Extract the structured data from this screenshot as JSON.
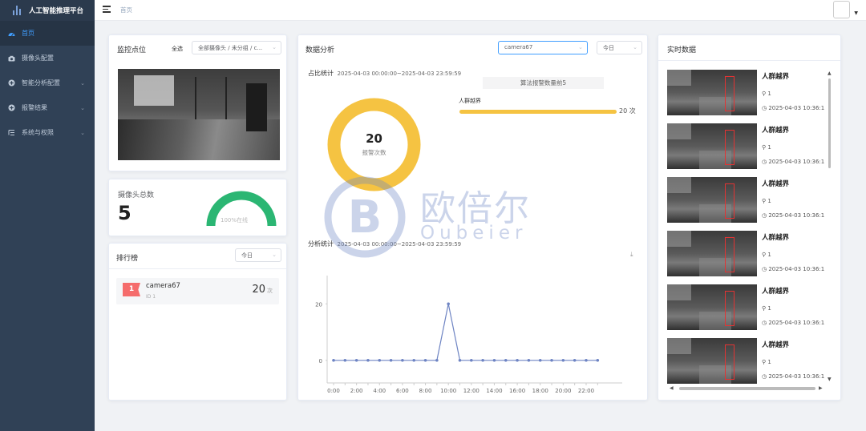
{
  "app": {
    "title": "人工智能推理平台"
  },
  "sidebar": {
    "items": [
      {
        "label": "首页",
        "icon": "dashboard-icon",
        "active": true
      },
      {
        "label": "摄像头配置",
        "icon": "camera-icon",
        "active": false
      },
      {
        "label": "智能分析配置",
        "icon": "plus-circle-icon",
        "active": false,
        "expandable": true
      },
      {
        "label": "报警结果",
        "icon": "plus-circle-icon",
        "active": false,
        "expandable": true
      },
      {
        "label": "系统与权限",
        "icon": "settings-list-icon",
        "active": false,
        "expandable": true
      }
    ]
  },
  "topbar": {
    "breadcrumb": "首页"
  },
  "monitor": {
    "title": "监控点位",
    "all_label": "全选",
    "camera_select": "全部摄像头 / 未分组 / c..."
  },
  "camera_total": {
    "label": "摄像头总数",
    "value": "5",
    "gauge_text": "100%在线",
    "gauge_percent": 100
  },
  "ranking": {
    "title": "排行榜",
    "period_select": "今日",
    "items": [
      {
        "rank": "1",
        "name": "camera67",
        "id_text": "ID 1",
        "count": "20",
        "unit": "次"
      }
    ]
  },
  "analysis": {
    "title": "数据分析",
    "camera_select": "camera67",
    "period_select": "今日",
    "ratio": {
      "label": "占比统计",
      "date_range": "2025-04-03 00:00:00~2025-04-03 23:59:59",
      "donut_value": "20",
      "donut_label": "报警次数",
      "top_title": "算法报警数量前5",
      "bars": [
        {
          "label": "人群越界",
          "value": 20,
          "display": "20 次"
        }
      ]
    },
    "trend": {
      "label": "分析统计",
      "date_range": "2025-04-03 00:00:00~2025-04-03 23:59:59"
    }
  },
  "chart_data": {
    "type": "line",
    "x": [
      "0:00",
      "1:00",
      "2:00",
      "3:00",
      "4:00",
      "5:00",
      "6:00",
      "7:00",
      "8:00",
      "9:00",
      "10:00",
      "11:00",
      "12:00",
      "13:00",
      "14:00",
      "15:00",
      "16:00",
      "17:00",
      "18:00",
      "19:00",
      "20:00",
      "21:00",
      "22:00",
      "23:00"
    ],
    "xticks": [
      "0:00",
      "2:00",
      "4:00",
      "6:00",
      "8:00",
      "10:00",
      "12:00",
      "14:00",
      "16:00",
      "18:00",
      "20:00",
      "22:00"
    ],
    "yticks": [
      0,
      20
    ],
    "ylim": [
      -8,
      30
    ],
    "series": [
      {
        "values": [
          0,
          0,
          0,
          0,
          0,
          0,
          0,
          0,
          0,
          0,
          20,
          0,
          0,
          0,
          0,
          0,
          0,
          0,
          0,
          0,
          0,
          0,
          0,
          0
        ],
        "color": "#6e84c3"
      }
    ]
  },
  "realtime": {
    "title": "实时数据",
    "items": [
      {
        "title": "人群越界",
        "location": "1",
        "time": "2025-04-03 10:36:1"
      },
      {
        "title": "人群越界",
        "location": "1",
        "time": "2025-04-03 10:36:1"
      },
      {
        "title": "人群越界",
        "location": "1",
        "time": "2025-04-03 10:36:1"
      },
      {
        "title": "人群越界",
        "location": "1",
        "time": "2025-04-03 10:36:1"
      },
      {
        "title": "人群越界",
        "location": "1",
        "time": "2025-04-03 10:36:1"
      },
      {
        "title": "人群越界",
        "location": "1",
        "time": "2025-04-03 10:36:1"
      }
    ]
  },
  "watermark": {
    "cn": "欧倍尔",
    "en": "Oubeier"
  },
  "colors": {
    "sidebar": "#304156",
    "accent": "#409eff",
    "donut": "#f5c342",
    "gauge": "#2bb673",
    "line": "#6e84c3",
    "rank_badge": "#f56c6c"
  }
}
